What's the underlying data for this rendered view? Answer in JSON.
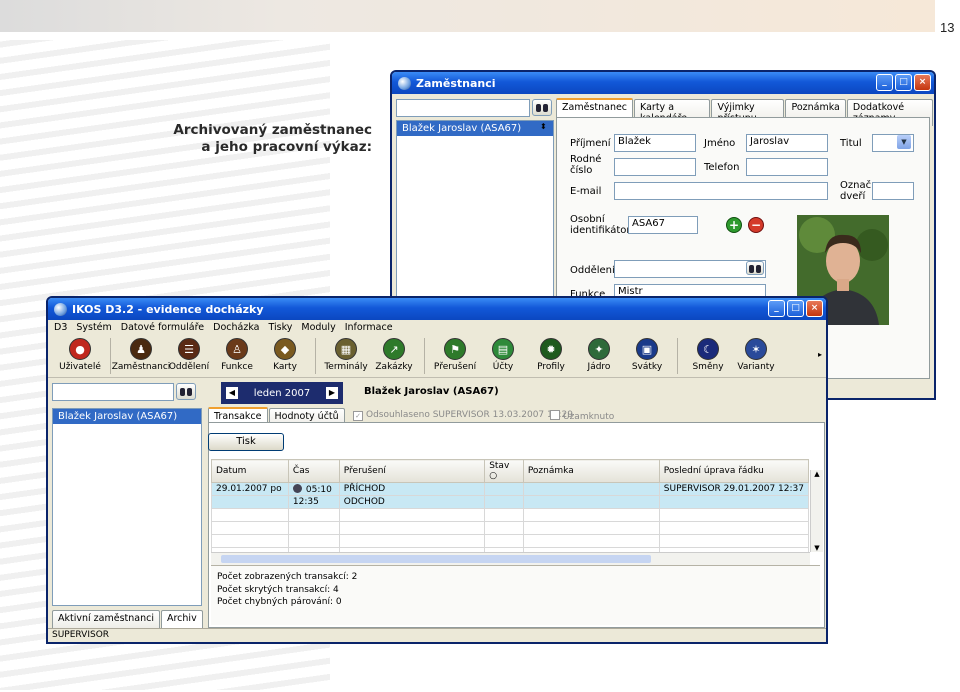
{
  "page": {
    "number": "13",
    "caption_line1": "Archivovaný zaměstnanec",
    "caption_line2": "a jeho pracovní výkaz:"
  },
  "employee_window": {
    "title": "Zaměstnanci",
    "search_value": "",
    "list_items": [
      "Blažek Jaroslav (ASA67)"
    ],
    "tabs": [
      "Zaměstnanec",
      "Karty a kalendáře",
      "Výjimky přístupu",
      "Poznámka",
      "Dodatkové záznamy"
    ],
    "labels": {
      "surname": "Příjmení",
      "first_name": "Jméno",
      "title": "Titul",
      "birth_number_1": "Rodné",
      "birth_number_2": "číslo",
      "phone": "Telefon",
      "email": "E-mail",
      "door_label_1": "Označ.",
      "door_label_2": "dveří",
      "personal_id_1": "Osobní",
      "personal_id_2": "identifikátor",
      "department": "Oddělení",
      "function": "Funkce"
    },
    "values": {
      "surname": "Blažek",
      "first_name": "Jaroslav",
      "title": "",
      "birth_number": "",
      "phone": "",
      "email": "",
      "door": "",
      "personal_id": "ASA67",
      "department": "",
      "function": "Mistr"
    },
    "add_symbol": "+",
    "remove_symbol": "−"
  },
  "main_window": {
    "title": "IKOS D3.2 - evidence docházky",
    "menu": [
      "D3",
      "Systém",
      "Datové formuláře",
      "Docházka",
      "Tisky",
      "Moduly",
      "Informace"
    ],
    "toolbar": [
      {
        "label": "Uživatelé",
        "icon": "users-icon",
        "color": "#c0281e"
      },
      {
        "label": "Zaměstnanci",
        "icon": "employees-icon",
        "color": "#4a2a10"
      },
      {
        "label": "Oddělení",
        "icon": "departments-icon",
        "color": "#5a2a14"
      },
      {
        "label": "Funkce",
        "icon": "function-icon",
        "color": "#6a3a1a"
      },
      {
        "label": "Karty",
        "icon": "cards-icon",
        "color": "#7a5a20"
      },
      {
        "label": "Terminály",
        "icon": "terminals-icon",
        "color": "#6a6030"
      },
      {
        "label": "Zakázky",
        "icon": "orders-icon",
        "color": "#2e7a2a"
      },
      {
        "label": "Přerušení",
        "icon": "interruption-icon",
        "color": "#2e7a2a"
      },
      {
        "label": "Účty",
        "icon": "accounts-icon",
        "color": "#2e8a3a"
      },
      {
        "label": "Profily",
        "icon": "profiles-icon",
        "color": "#1e5a1e"
      },
      {
        "label": "Jádro",
        "icon": "core-icon",
        "color": "#2e6a3a"
      },
      {
        "label": "Svátky",
        "icon": "holidays-icon",
        "color": "#1a3a8a"
      },
      {
        "label": "Směny",
        "icon": "shifts-icon",
        "color": "#1a2a7a"
      },
      {
        "label": "Varianty",
        "icon": "variants-icon",
        "color": "#2a4a9a"
      }
    ],
    "toolbar_more": "▸",
    "search_value": "",
    "employee_list": [
      "Blažek Jaroslav (ASA67)"
    ],
    "month_label": "leden 2007",
    "employee_header": "Blažek Jaroslav (ASA67)",
    "tabs": [
      "Transakce",
      "Hodnoty účtů"
    ],
    "approved_text": "Odsouhlaseno SUPERVISOR 13.03.2007 11:29",
    "locked_text": "Uzamknuto",
    "print_button": "Tisk",
    "columns": [
      "Datum",
      "Čas",
      "Přerušení",
      "Stav",
      "Poznámka",
      "Poslední úprava řádku"
    ],
    "rows": [
      {
        "date": "29.01.2007 po",
        "time": "05:10",
        "interruption": "PŘÍCHOD",
        "state": "",
        "note": "",
        "last_edit": "SUPERVISOR 29.01.2007 12:37"
      },
      {
        "date": "",
        "time": "12:35",
        "interruption": "ODCHOD",
        "state": "",
        "note": "",
        "last_edit": ""
      }
    ],
    "stats": [
      "Počet zobrazených transakcí: 2",
      "Počet skrytých transakcí: 4",
      "Počet chybných párování: 0"
    ],
    "bottom_tabs": [
      "Aktivní zaměstnanci",
      "Archiv"
    ],
    "status": "SUPERVISOR"
  },
  "colors": {
    "title_bar": "#0b47c0",
    "selection": "#316ac5",
    "month_nav": "#1d2c6e",
    "row_highlight": "#c8e8f4"
  }
}
